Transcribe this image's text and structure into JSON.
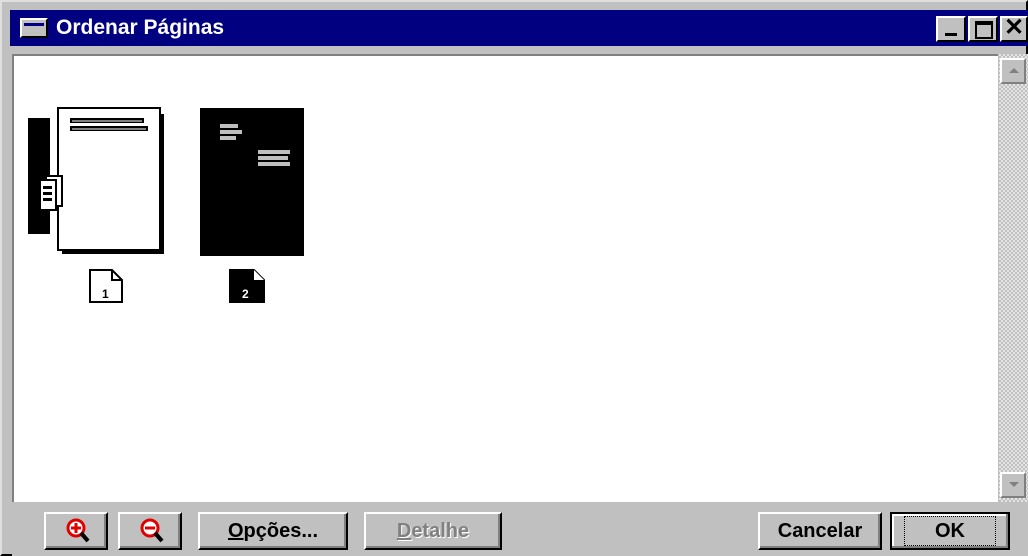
{
  "window": {
    "title": "Ordenar Páginas",
    "colors": {
      "titlebar": "#000080",
      "face": "#c0c0c0",
      "content": "#ffffff",
      "zoom_icon": "#e00000"
    }
  },
  "pages": [
    {
      "number": "1",
      "style": "white"
    },
    {
      "number": "2",
      "style": "black"
    }
  ],
  "buttons": {
    "zoom_in_icon": "zoom-in-icon",
    "zoom_out_icon": "zoom-out-icon",
    "options": "Opções...",
    "detail": "Detalhe",
    "cancel": "Cancelar",
    "ok": "OK"
  }
}
